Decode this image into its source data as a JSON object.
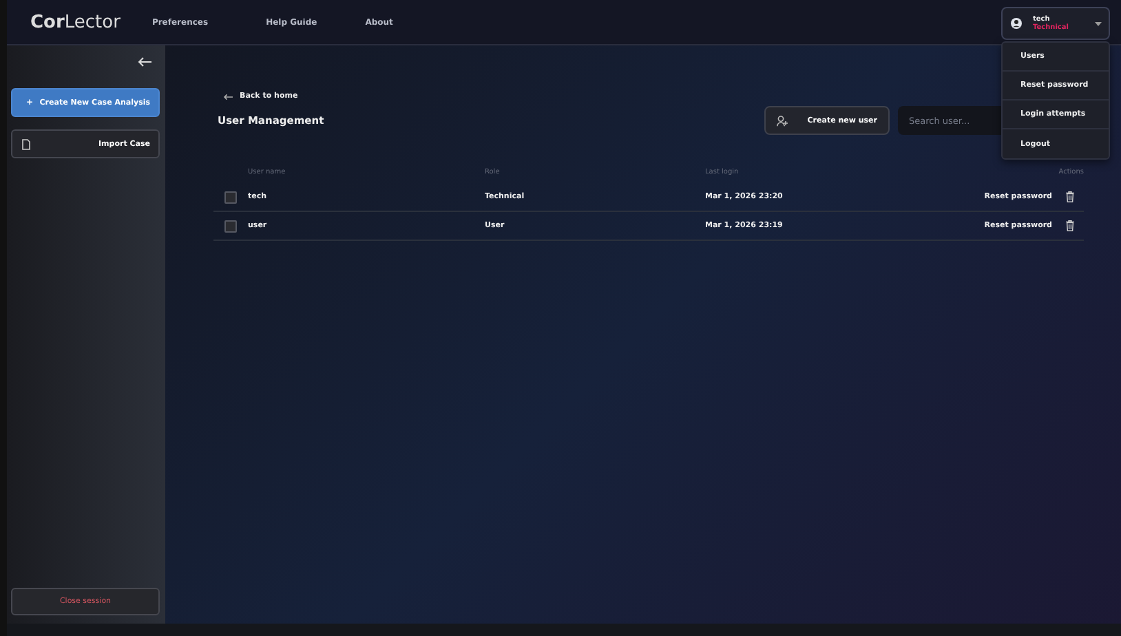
{
  "app": {
    "logo_bold": "Cor",
    "logo_rest": "Lector"
  },
  "nav": [
    "Preferences",
    "Help Guide",
    "About"
  ],
  "account": {
    "name": "tech",
    "role": "Technical",
    "expanded": true
  },
  "account_menu": [
    "Users",
    "Reset password",
    "Login attempts",
    "Logout"
  ],
  "sidebar": {
    "buttons": [
      {
        "kind": "primary",
        "icon": "+",
        "label": "Create New Case Analysis"
      },
      {
        "kind": "secondary",
        "label": "Import Case"
      }
    ],
    "close": "Close session"
  },
  "page": {
    "back": "Back to home",
    "title": "User Management",
    "create": "Create new user",
    "search": {
      "placeholder": "Search user..."
    }
  },
  "table": {
    "columns": [
      "User name",
      "Role",
      "Last login",
      "Actions"
    ],
    "rows": [
      {
        "checked": false,
        "name": "tech",
        "role": "Technical",
        "last_login": "Mar 1, 2026  23:20",
        "action": "Reset password"
      },
      {
        "checked": false,
        "name": "user",
        "role": "User",
        "last_login": "Mar 1, 2026  23:19",
        "action": "Reset password"
      }
    ]
  }
}
